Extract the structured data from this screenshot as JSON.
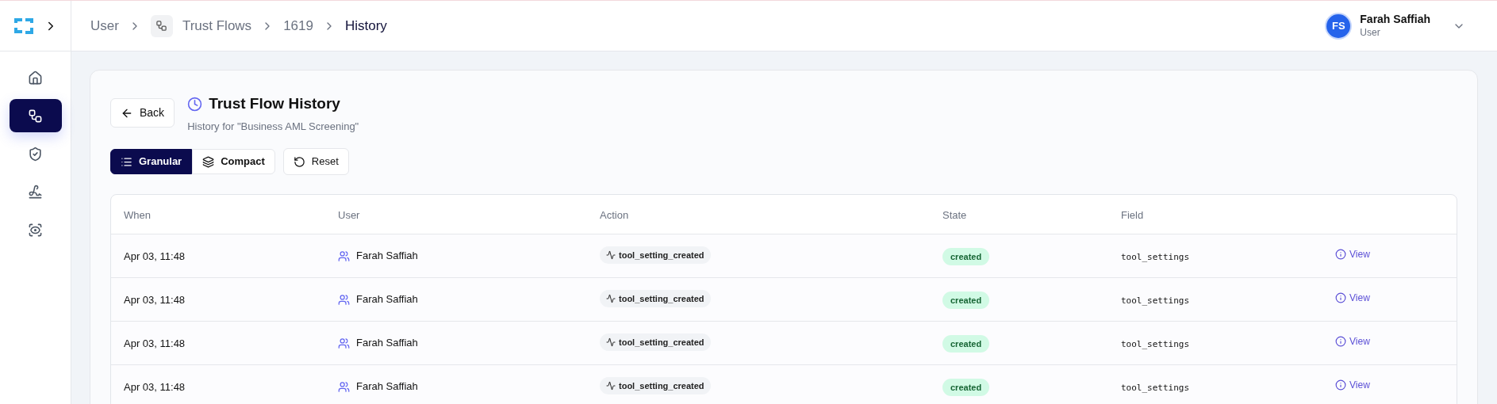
{
  "sidebar": {
    "items": [
      {
        "kind": "home",
        "selected": false
      },
      {
        "kind": "flows",
        "selected": true
      },
      {
        "kind": "shield",
        "selected": false
      },
      {
        "kind": "signature",
        "selected": false
      },
      {
        "kind": "eye",
        "selected": false
      }
    ]
  },
  "breadcrumbs": [
    {
      "label": "User",
      "current": false,
      "icon": false
    },
    {
      "label": "Trust Flows",
      "current": false,
      "icon": true
    },
    {
      "label": "1619",
      "current": false,
      "icon": false
    },
    {
      "label": "History",
      "current": true,
      "icon": false
    }
  ],
  "user": {
    "initials": "FS",
    "name": "Farah Saffiah",
    "role": "User"
  },
  "page": {
    "back": "Back",
    "title": "Trust Flow History",
    "subtitle": "History for \"Business AML Screening\""
  },
  "view_modes": [
    {
      "kind": "list",
      "label": "Granular",
      "selected": true
    },
    {
      "kind": "layers",
      "label": "Compact",
      "selected": false
    }
  ],
  "reset": "Reset",
  "table": {
    "columns": [
      "When",
      "User",
      "Action",
      "State",
      "Field"
    ],
    "rows": [
      {
        "when": "Apr 03, 11:48",
        "user": "Farah Saffiah",
        "action": "tool_setting_created",
        "state": "created",
        "field": "tool_settings",
        "link": "View"
      },
      {
        "when": "Apr 03, 11:48",
        "user": "Farah Saffiah",
        "action": "tool_setting_created",
        "state": "created",
        "field": "tool_settings",
        "link": "View"
      },
      {
        "when": "Apr 03, 11:48",
        "user": "Farah Saffiah",
        "action": "tool_setting_created",
        "state": "created",
        "field": "tool_settings",
        "link": "View"
      },
      {
        "when": "Apr 03, 11:48",
        "user": "Farah Saffiah",
        "action": "tool_setting_created",
        "state": "created",
        "field": "tool_settings",
        "link": "View"
      }
    ]
  }
}
